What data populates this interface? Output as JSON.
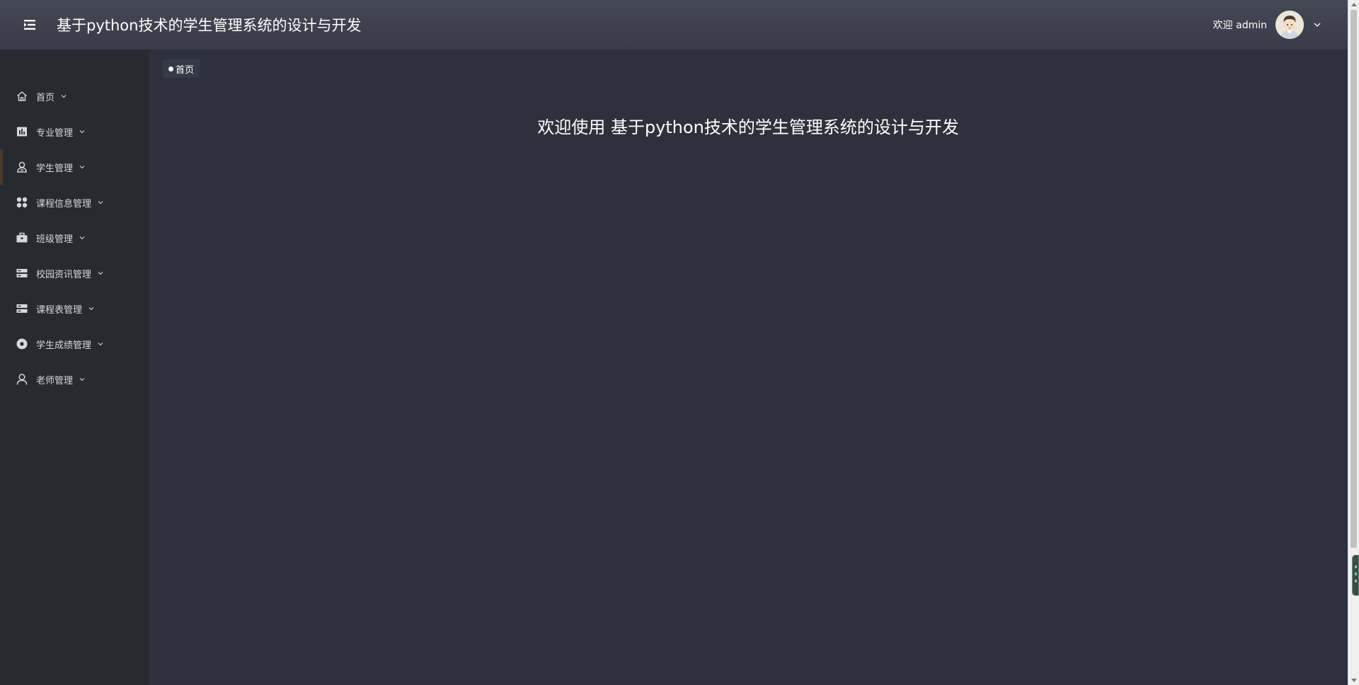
{
  "header": {
    "title": "基于python技术的学生管理系统的设计与开发",
    "welcome": "欢迎 admin",
    "menu_icon": "menu-fold-icon",
    "avatar_icon": "user-avatar"
  },
  "sidebar": {
    "items": [
      {
        "label": "首页",
        "icon": "home-icon"
      },
      {
        "label": "专业管理",
        "icon": "chart-icon"
      },
      {
        "label": "学生管理",
        "icon": "person-icon"
      },
      {
        "label": "课程信息管理",
        "icon": "grid-icon"
      },
      {
        "label": "班级管理",
        "icon": "briefcase-icon"
      },
      {
        "label": "校园资讯管理",
        "icon": "server-icon"
      },
      {
        "label": "课程表管理",
        "icon": "server-icon"
      },
      {
        "label": "学生成绩管理",
        "icon": "target-icon"
      },
      {
        "label": "老师管理",
        "icon": "user-icon"
      }
    ],
    "active_index": 2
  },
  "main": {
    "breadcrumb": "首页",
    "welcome_banner": "欢迎使用 基于python技术的学生管理系统的设计与开发"
  },
  "colors": {
    "header_bg": "#41444f",
    "sidebar_bg": "#272a31",
    "main_bg": "#2e313c",
    "text": "#ffffff",
    "nav_text": "#d5d8de"
  }
}
